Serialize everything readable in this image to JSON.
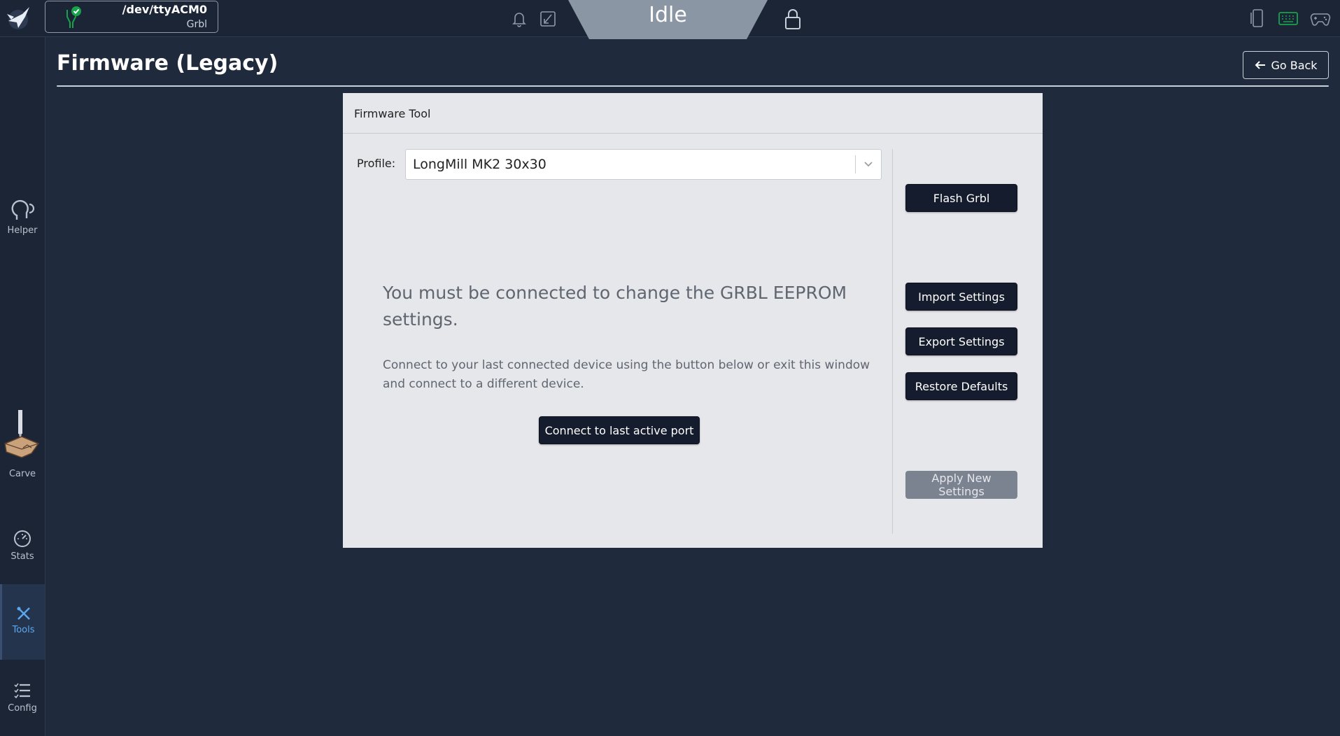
{
  "connection": {
    "port": "/dev/ttyACM0",
    "firmware": "Grbl"
  },
  "status": {
    "state": "Idle"
  },
  "sidebar": {
    "items": [
      {
        "label": "Helper"
      },
      {
        "label": "Carve"
      },
      {
        "label": "Stats"
      },
      {
        "label": "Tools"
      },
      {
        "label": "Config"
      }
    ]
  },
  "page": {
    "title": "Firmware (Legacy)",
    "back_label": "Go Back"
  },
  "panel": {
    "title": "Firmware Tool",
    "profile_label": "Profile:",
    "profile_value": "LongMill MK2 30x30",
    "message_heading": "You must be connected to change the GRBL EEPROM settings.",
    "message_body": "Connect to your last connected device using the button below or exit this window and connect to a different device.",
    "connect_label": "Connect to last active port",
    "buttons": {
      "flash": "Flash Grbl",
      "import": "Import Settings",
      "export": "Export Settings",
      "restore": "Restore Defaults",
      "apply": "Apply New Settings"
    }
  },
  "colors": {
    "accent_active": "#5aa9f0",
    "connected": "#16a34a",
    "background": "#1f2a3c"
  }
}
